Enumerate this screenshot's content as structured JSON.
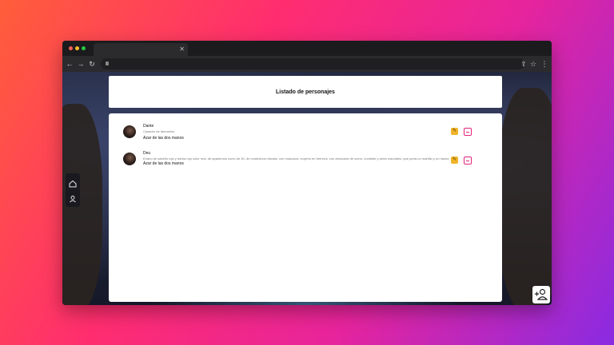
{
  "header": {
    "title": "Listado de personajes"
  },
  "characters": [
    {
      "name": "Dante",
      "description": "Cazador de demonios",
      "style": "Azar de las dos manos"
    },
    {
      "name": "Deu",
      "description": "Enano de sabello rojo y barba rojo color real, de apariencia como de 30, de contextura robusta, con músculos, experto en herrería, con armadura de cuero, combate y artes marciales, que porta un martillo y un hacha",
      "style": "Azar de las dos manos"
    }
  ],
  "icons": {
    "edit": "pencil-icon",
    "delete": "minus-icon",
    "home": "home-icon",
    "user": "user-icon",
    "add_user": "add-user-icon"
  },
  "colors": {
    "edit_button": "#f0b429",
    "delete_border": "#e0247a",
    "card_background": "#ffffff"
  }
}
